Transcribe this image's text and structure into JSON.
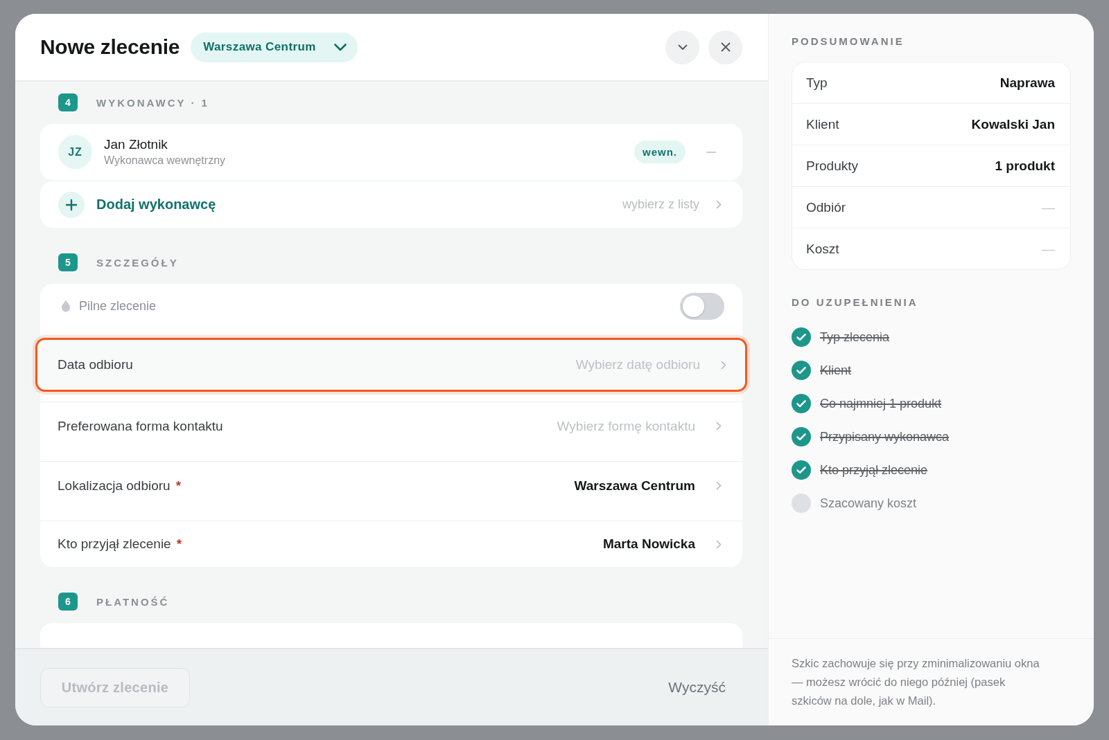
{
  "header": {
    "title": "Nowe zlecenie",
    "location": "Warszawa Centrum"
  },
  "sections": [
    {
      "kind": "contractors",
      "number": "4",
      "title": "WYKONAWCY · 1",
      "contractors": [
        {
          "initials": "JZ",
          "name": "Jan Złotnik",
          "role": "Wykonawca wewnętrzny",
          "tag": "wewn."
        }
      ],
      "add": {
        "label": "Dodaj wykonawcę",
        "hint": "wybierz z listy"
      }
    },
    {
      "kind": "details",
      "number": "5",
      "title": "SZCZEGÓŁY",
      "fields": [
        {
          "kind": "toggle",
          "label": "Pilne zlecenie",
          "on": false
        },
        {
          "kind": "select",
          "label": "Data odbioru",
          "placeholder": "Wybierz datę odbioru",
          "focused": true
        },
        {
          "kind": "select",
          "label": "Preferowana forma kontaktu",
          "placeholder": "Wybierz formę kontaktu",
          "focused": false
        },
        {
          "kind": "select",
          "label": "Lokalizacja odbioru",
          "required_mark": "*",
          "value": "Warszawa Centrum",
          "focused": false
        },
        {
          "kind": "select",
          "label": "Kto przyjął zlecenie",
          "required_mark": "*",
          "value": "Marta Nowicka",
          "focused": false
        }
      ]
    },
    {
      "kind": "payment",
      "number": "6",
      "title": "PŁATNOŚĆ"
    }
  ],
  "footer": {
    "create_button": {
      "label": "Utwórz zlecenie",
      "disabled": true
    },
    "clear_button": {
      "label": "Wyczyść"
    }
  },
  "summary": {
    "title": "PODSUMOWANIE",
    "rows": [
      {
        "label": "Typ",
        "value": "Naprawa",
        "muted": false
      },
      {
        "label": "Klient",
        "value": "Kowalski Jan",
        "muted": false
      },
      {
        "label": "Produkty",
        "value": "1 produkt",
        "muted": false
      },
      {
        "label": "Odbiór",
        "value": "—",
        "muted": true
      },
      {
        "label": "Koszt",
        "value": "—",
        "muted": true
      }
    ]
  },
  "checklist": {
    "title": "DO UZUPEŁNIENIA",
    "items": [
      {
        "label": "Typ zlecenia",
        "checked": true
      },
      {
        "label": "Klient",
        "checked": true
      },
      {
        "label": "Co najmniej 1 produkt",
        "checked": true
      },
      {
        "label": "Przypisany wykonawca",
        "checked": true
      },
      {
        "label": "Kto przyjął zlecenie",
        "checked": true
      },
      {
        "label": "Szacowany koszt",
        "checked": false
      }
    ]
  },
  "note": "Szkic zachowuje się przy zminimalizowaniu okna — możesz wrócić do niego później (pasek szkiców na dole, jak w Mail)."
}
